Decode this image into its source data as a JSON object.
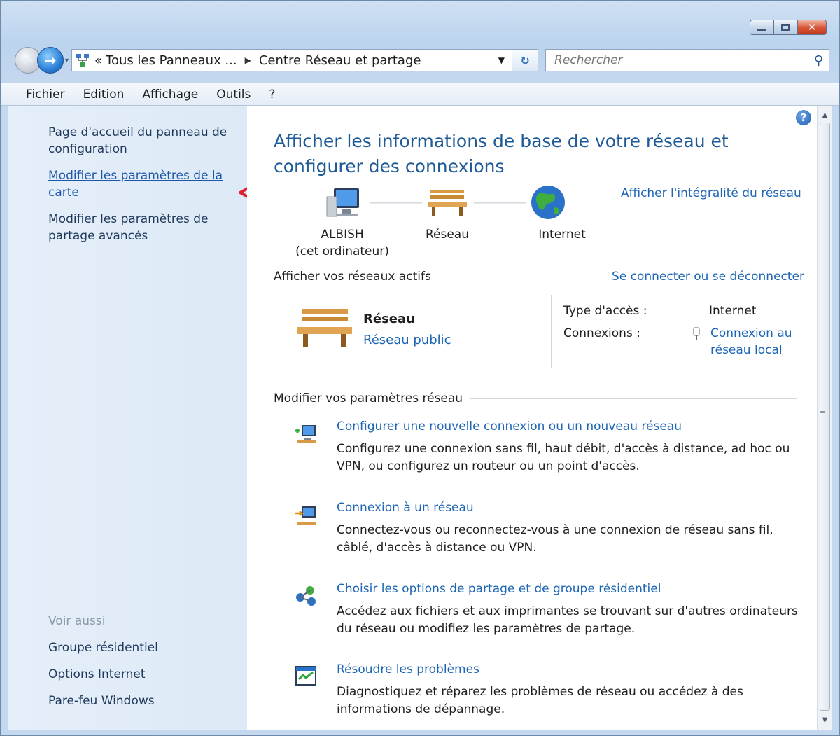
{
  "window": {
    "close_glyph": "✕"
  },
  "address": {
    "recent_glyph": "▾",
    "overflow": "«",
    "crumb1": "Tous les Panneaux ...",
    "sep": "▶",
    "crumb2": "Centre Réseau et partage",
    "dropdown": "▼",
    "refresh": "↻"
  },
  "search": {
    "placeholder": "Rechercher"
  },
  "menu": [
    "Fichier",
    "Edition",
    "Affichage",
    "Outils",
    "?"
  ],
  "sidebar": {
    "items": [
      "Page d'accueil du panneau de configuration",
      "Modifier les paramètres de la carte",
      "Modifier les paramètres de partage avancés"
    ],
    "see_also_title": "Voir aussi",
    "see_also": [
      "Groupe résidentiel",
      "Options Internet",
      "Pare-feu Windows"
    ]
  },
  "main": {
    "heading": "Afficher les informations de base de votre réseau et configurer des connexions",
    "full_network_link": "Afficher l'intégralité du réseau",
    "help": "?",
    "map": {
      "computer_name": "ALBISH",
      "computer_sub": "(cet ordinateur)",
      "network": "Réseau",
      "internet": "Internet"
    },
    "active_section": "Afficher vos réseaux actifs",
    "connect_link": "Se connecter ou se déconnecter",
    "active": {
      "name": "Réseau",
      "type": "Réseau public",
      "access_label": "Type d'accès :",
      "access_value": "Internet",
      "connections_label": "Connexions :",
      "connections_value_1": "Connexion au",
      "connections_value_2": "réseau local"
    },
    "change_section": "Modifier vos paramètres réseau",
    "tasks": [
      {
        "link": "Configurer une nouvelle connexion ou un nouveau réseau",
        "desc": "Configurez une connexion sans fil, haut débit, d'accès à distance, ad hoc ou VPN, ou configurez un routeur ou un point d'accès."
      },
      {
        "link": "Connexion à un réseau",
        "desc": "Connectez-vous ou reconnectez-vous à une connexion de réseau sans fil, câblé, d'accès à distance ou VPN."
      },
      {
        "link": "Choisir les options de partage et de groupe résidentiel",
        "desc": "Accédez aux fichiers et aux imprimantes se trouvant sur d'autres ordinateurs du réseau ou modifiez les paramètres de partage."
      },
      {
        "link": "Résoudre les problèmes",
        "desc": "Diagnostiquez et réparez les problèmes de réseau ou accédez à des informations de dépannage."
      }
    ]
  },
  "scroll": {
    "up": "▲",
    "down": "▼",
    "grip": "≡"
  },
  "icons": [
    "minimize-icon",
    "maximize-icon",
    "close-icon",
    "back-arrow-icon",
    "forward-arrow-icon",
    "network-location-icon",
    "refresh-icon",
    "search-icon",
    "help-icon",
    "computer-icon",
    "bench-network-icon",
    "globe-icon",
    "network-plug-icon",
    "new-connection-icon",
    "connect-icon",
    "homegroup-icon",
    "troubleshoot-icon",
    "red-arrow-annotation"
  ],
  "colors": {
    "link": "#1d66b5",
    "heading": "#1e5a96",
    "sidebar_bg": "#e5effa",
    "annotation": "#e0202a"
  }
}
